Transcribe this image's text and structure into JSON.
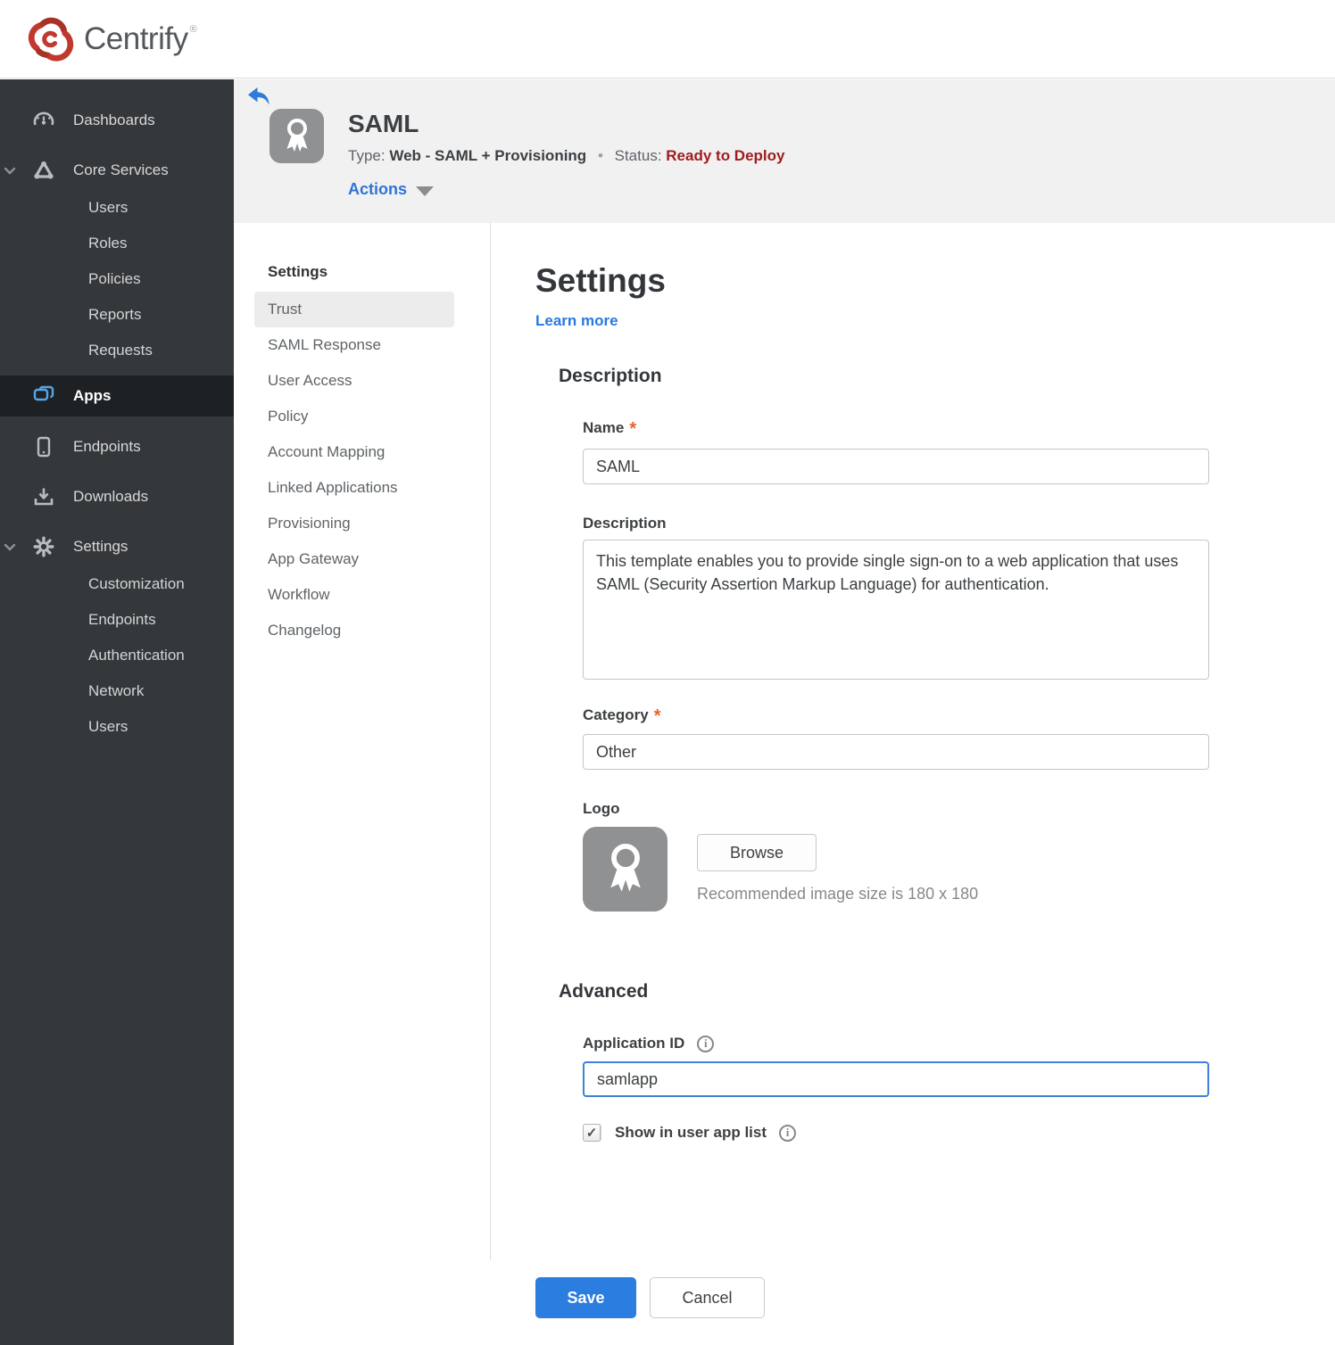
{
  "brand": {
    "name": "Centrify",
    "registered": "®"
  },
  "colors": {
    "accent_blue": "#2b7de0",
    "status_red": "#9e1c1c",
    "required_orange": "#e8642c",
    "apps_icon_blue": "#55a6e8",
    "brand_red": "#c0392f",
    "sidebar_bg": "#34383b"
  },
  "sidebar": {
    "dashboards": "Dashboards",
    "core_services": "Core Services",
    "core_children": [
      "Users",
      "Roles",
      "Policies",
      "Reports",
      "Requests"
    ],
    "apps": "Apps",
    "endpoints": "Endpoints",
    "downloads": "Downloads",
    "settings": "Settings",
    "settings_children": [
      "Customization",
      "Endpoints",
      "Authentication",
      "Network",
      "Users"
    ]
  },
  "header": {
    "title": "SAML",
    "type_label": "Type:",
    "type_value": "Web - SAML + Provisioning",
    "dot": "•",
    "status_label": "Status:",
    "status_value": "Ready to Deploy",
    "actions": "Actions"
  },
  "subnav": {
    "heading": "Settings",
    "selected": "Trust",
    "items": [
      "Trust",
      "SAML Response",
      "User Access",
      "Policy",
      "Account Mapping",
      "Linked Applications",
      "Provisioning",
      "App Gateway",
      "Workflow",
      "Changelog"
    ]
  },
  "main": {
    "heading": "Settings",
    "learn_more": "Learn more",
    "description_section": "Description",
    "name_label": "Name",
    "required_mark": "*",
    "name_value": "SAML",
    "description_label": "Description",
    "description_value": "This template enables you to provide single sign-on to a web application that uses SAML (Security Assertion Markup Language) for authentication.",
    "category_label": "Category",
    "category_value": "Other",
    "logo_label": "Logo",
    "browse_button": "Browse",
    "logo_hint": "Recommended image size is 180 x 180",
    "advanced_section": "Advanced",
    "application_id_label": "Application ID",
    "application_id_value": "samlapp",
    "show_in_list_label": "Show in user app list",
    "checkbox_glyph": "✓",
    "save_button": "Save",
    "cancel_button": "Cancel"
  }
}
